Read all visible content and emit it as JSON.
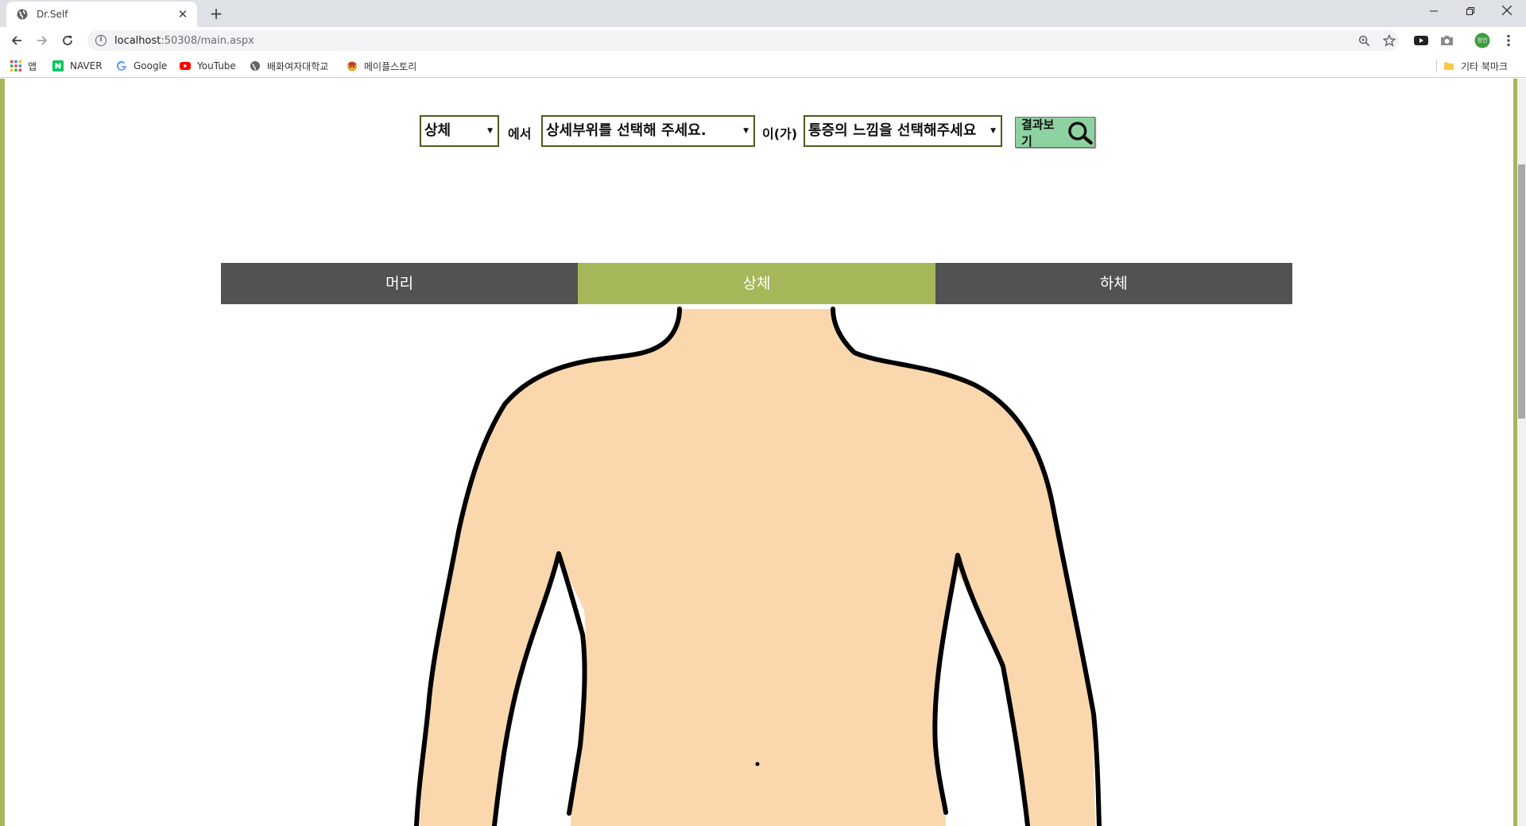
{
  "browser": {
    "tab_title": "Dr.Self",
    "url_host": "localhost",
    "url_rest": ":50308/main.aspx",
    "bookmarks": [
      {
        "label": "앱",
        "icon": "apps-grid-icon"
      },
      {
        "label": "NAVER",
        "icon": "naver-icon"
      },
      {
        "label": "Google",
        "icon": "google-icon"
      },
      {
        "label": "YouTube",
        "icon": "youtube-icon"
      },
      {
        "label": "배화여자대학교",
        "icon": "globe-icon"
      },
      {
        "label": "메이플스토리",
        "icon": "maplestory-icon"
      }
    ],
    "other_bookmarks": "기타 북마크",
    "profile_initials": "정인"
  },
  "form": {
    "region_select": "상체",
    "label_in": "에서",
    "detail_select": "상세부위를 선택해 주세요.",
    "label_subject": "이(가)",
    "symptom_select": "통증의 느낌을 선택해주세요",
    "result_button": "결과보기"
  },
  "tabs": [
    {
      "label": "머리",
      "active": false
    },
    {
      "label": "상체",
      "active": true
    },
    {
      "label": "하체",
      "active": false
    }
  ],
  "colors": {
    "accent_green": "#a4b85a",
    "tab_dark": "#525252",
    "skin": "#fad7ad",
    "button_green": "#8ed2a2"
  }
}
